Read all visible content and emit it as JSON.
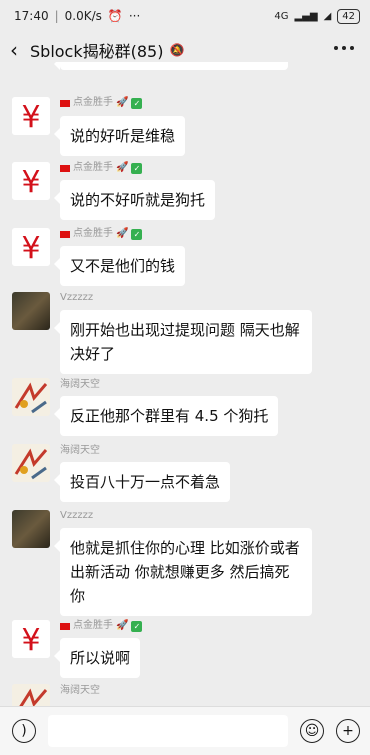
{
  "status_bar": {
    "time": "17:40",
    "speed": "0.0K/s",
    "network": "4G",
    "battery": "42"
  },
  "nav": {
    "back_icon": "chevron-left-icon",
    "title": "Sblock揭秘群(85)",
    "mute_icon": "mute-icon",
    "more_icon": "more-icon"
  },
  "messages": [
    {
      "sender": "点金胜手",
      "text": "说的好听是维稳",
      "avatar": "red-yen"
    },
    {
      "sender": "点金胜手",
      "text": "说的不好听就是狗托",
      "avatar": "red-yen"
    },
    {
      "sender": "点金胜手",
      "text": "又不是他们的钱",
      "avatar": "red-yen"
    },
    {
      "sender": "Vzzzzz",
      "text": "刚开始也出现过提现问题 隔天也解决好了",
      "avatar": "dark"
    },
    {
      "sender": "海阔天空",
      "text": "反正他那个群里有 4.5 个狗托",
      "avatar": "art"
    },
    {
      "sender": "海阔天空",
      "text": "投百八十万一点不着急",
      "avatar": "art"
    },
    {
      "sender": "Vzzzzz",
      "text": "他就是抓住你的心理 比如涨价或者出新活动  你就想赚更多  然后搞死你",
      "avatar": "dark"
    },
    {
      "sender": "点金胜手",
      "text": "所以说啊",
      "avatar": "red-yen"
    },
    {
      "sender": "海阔天空",
      "text": "",
      "avatar": "art"
    }
  ],
  "input_bar": {
    "voice_icon": "voice-icon",
    "emoji_icon": "emoji-icon",
    "plus_icon": "plus-icon"
  }
}
